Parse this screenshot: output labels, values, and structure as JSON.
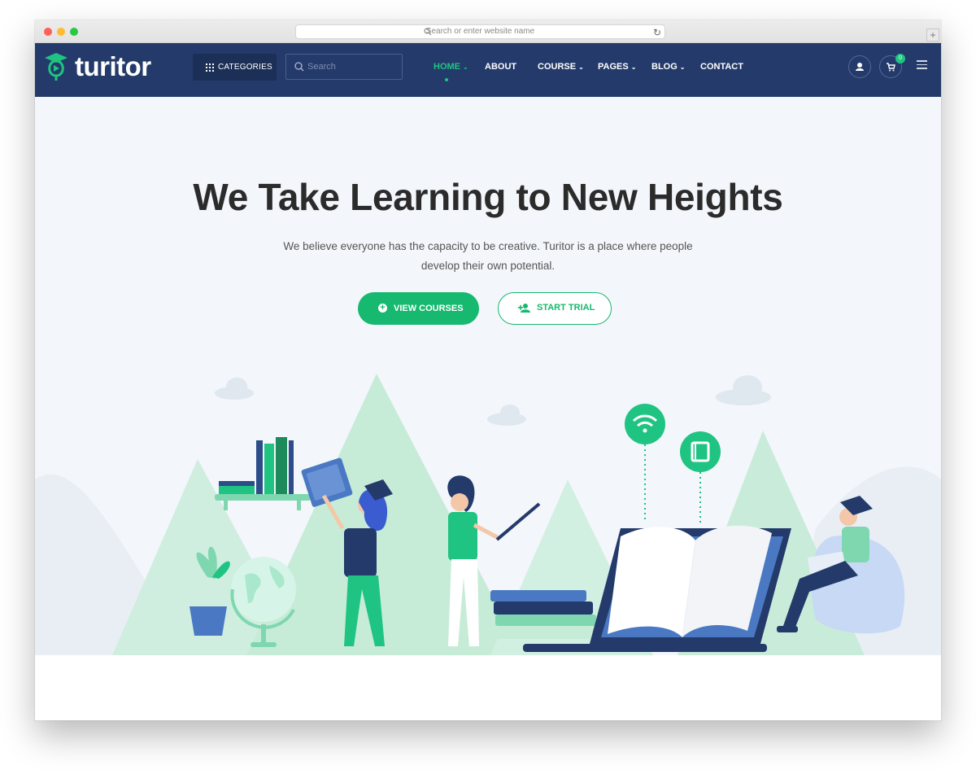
{
  "browser": {
    "url_placeholder": "Search or enter website name",
    "reload_icon": "reload-icon",
    "new_tab_label": "+"
  },
  "nav": {
    "logo_text": "turitor",
    "categories_label": "CATEGORIES",
    "search_placeholder": "Search",
    "menu": [
      {
        "label": "HOME",
        "has_dropdown": true,
        "active": true
      },
      {
        "label": "ABOUT",
        "has_dropdown": false,
        "active": false
      },
      {
        "label": "COURSE",
        "has_dropdown": true,
        "active": false
      },
      {
        "label": "PAGES",
        "has_dropdown": true,
        "active": false
      },
      {
        "label": "BLOG",
        "has_dropdown": true,
        "active": false
      },
      {
        "label": "CONTACT",
        "has_dropdown": false,
        "active": false
      }
    ],
    "cart_count": "0",
    "icons": [
      "user-icon",
      "cart-icon",
      "menu-icon"
    ]
  },
  "hero": {
    "title": "We Take Learning to New Heights",
    "subtitle_line1": "We believe everyone has the capacity to be creative. Turitor is a place where people",
    "subtitle_line2": "develop their own potential.",
    "primary_button": "VIEW COURSES",
    "secondary_button": "START TRIAL"
  },
  "colors": {
    "nav_bg": "#233a6a",
    "accent": "#17b86f",
    "hero_bg": "#f3f6fa",
    "text_dark": "#2b2b2b"
  }
}
